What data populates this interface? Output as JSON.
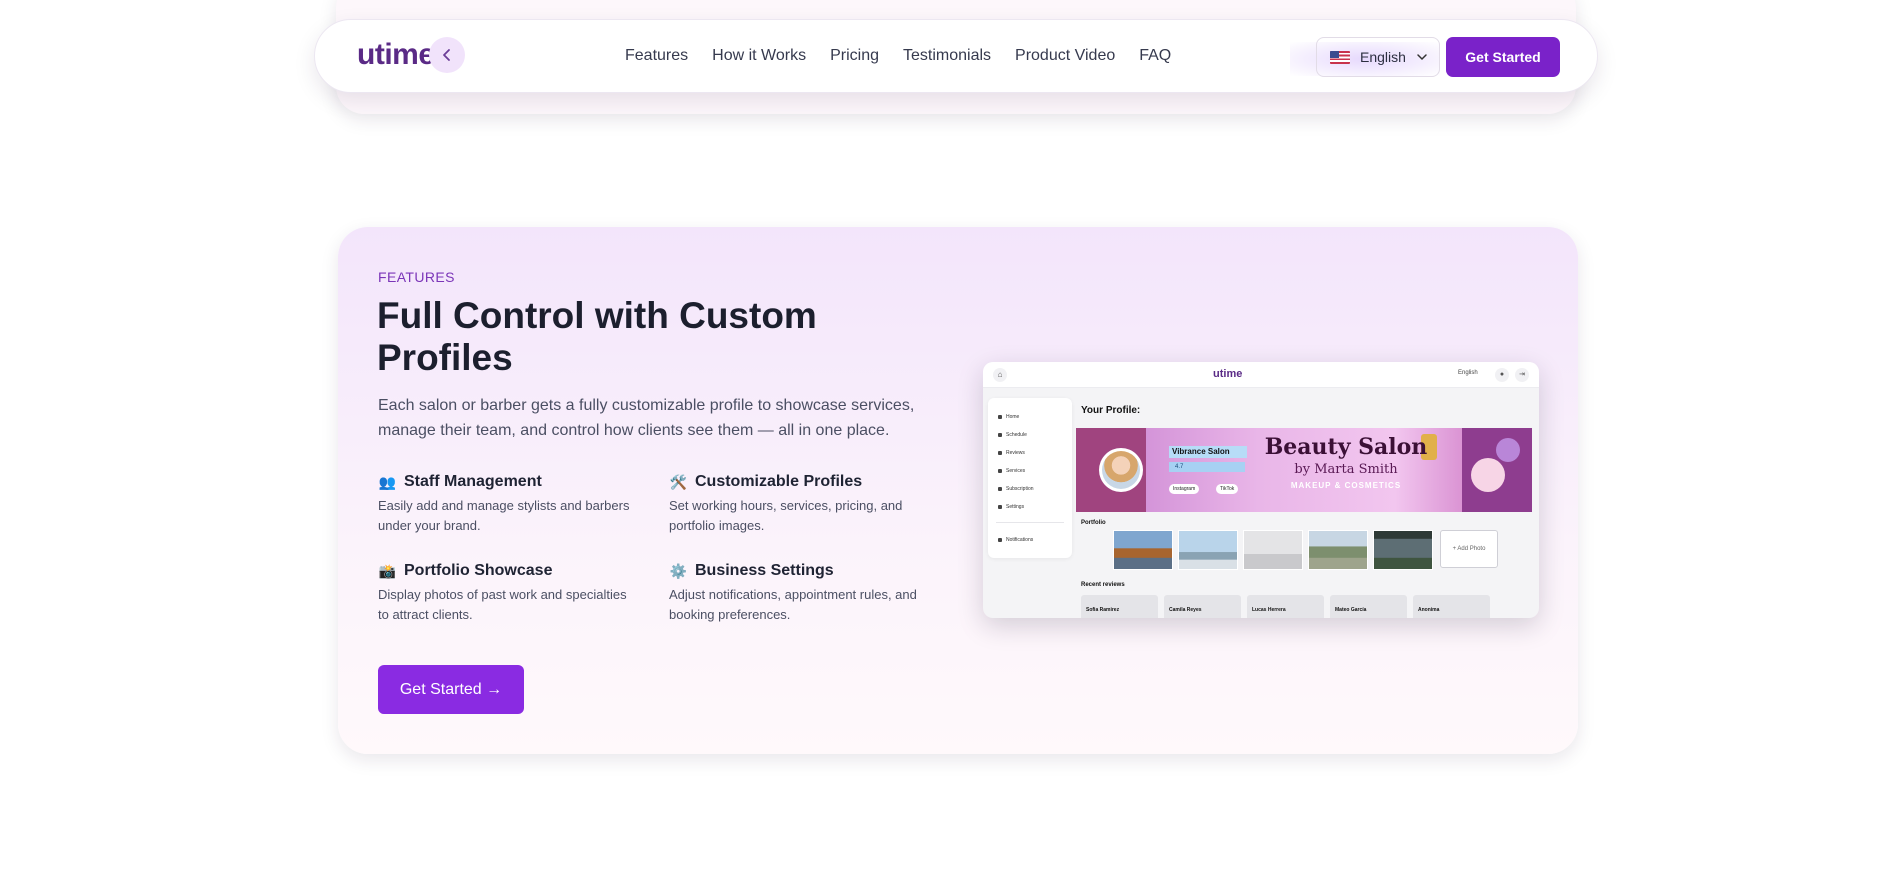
{
  "nav": {
    "logo": "utime",
    "links": [
      "Features",
      "How it Works",
      "Pricing",
      "Testimonials",
      "Product Video",
      "FAQ"
    ],
    "language": "English",
    "cta": "Get Started"
  },
  "features": {
    "eyebrow": "FEATURES",
    "title": "Full Control with Custom Profiles",
    "description": "Each salon or barber gets a fully customizable profile to showcase services, manage their team, and control how clients see them — all in one place.",
    "items": [
      {
        "emoji": "👥",
        "title": "Staff Management",
        "desc": "Easily add and manage stylists and barbers under your brand."
      },
      {
        "emoji": "🛠️",
        "title": "Customizable Profiles",
        "desc": "Set working hours, services, pricing, and portfolio images."
      },
      {
        "emoji": "📸",
        "title": "Portfolio Showcase",
        "desc": "Display photos of past work and specialties to attract clients."
      },
      {
        "emoji": "⚙️",
        "title": "Business Settings",
        "desc": "Adjust notifications, appointment rules, and booking preferences."
      }
    ],
    "cta": "Get Started →"
  },
  "mockup": {
    "logo": "utime",
    "language": "English",
    "sidebar": [
      "Home",
      "Schedule",
      "Reviews",
      "Services",
      "Subscription",
      "Settings"
    ],
    "sidebar_bottom": "Notifications",
    "page_title": "Your Profile:",
    "banner_title": "Beauty Salon",
    "banner_subtitle": "by Marta Smith",
    "banner_tagline": "MAKEUP & COSMETICS",
    "salon_name": "Vibrance Salon",
    "salon_rating": "4.7",
    "social_1": "Instagram",
    "social_2": "TikTok",
    "portfolio_label": "Portfolio",
    "add_photo": "+ Add Photo",
    "reviews_label": "Recent reviews",
    "reviewers": [
      "Sofia Ramirez",
      "Camila Reyes",
      "Lucas Herrera",
      "Mateo García",
      "Anonima"
    ]
  },
  "colors": {
    "brand_purple": "#7a22c9",
    "cta_purple": "#8a2be2",
    "eyebrow": "#7b35b8"
  }
}
